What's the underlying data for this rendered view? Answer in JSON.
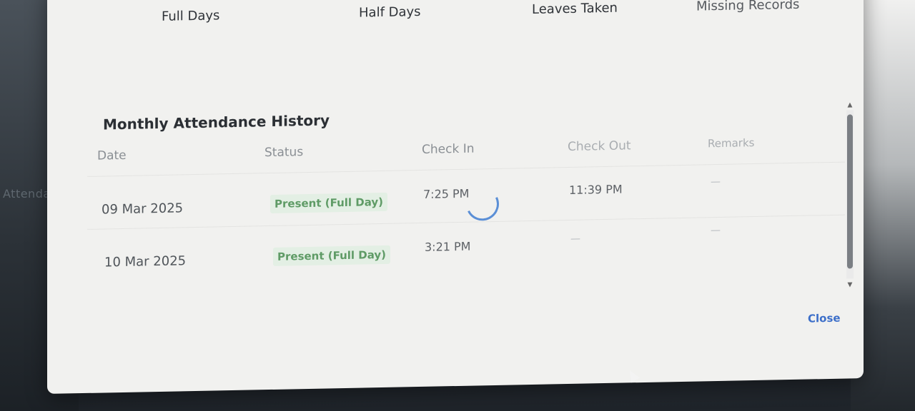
{
  "background": {
    "side_text": "Attenda"
  },
  "stats": {
    "labels": [
      "Full Days",
      "Half Days",
      "Leaves Taken",
      "Missing Records"
    ]
  },
  "history": {
    "title": "Monthly Attendance History",
    "columns": [
      "Date",
      "Status",
      "Check In",
      "Check Out",
      "Remarks"
    ],
    "rows": [
      {
        "date": "09 Mar 2025",
        "status": "Present (Full Day)",
        "check_in": "7:25 PM",
        "check_out": "11:39 PM",
        "remarks": "—"
      },
      {
        "date": "10 Mar 2025",
        "status": "Present (Full Day)",
        "check_in": "3:21 PM",
        "check_out": "—",
        "remarks": "—"
      }
    ]
  },
  "actions": {
    "close_label": "Close"
  },
  "colors": {
    "accent_blue": "#3d6fc9",
    "status_green": "#5f9b66",
    "status_bg": "#e3efe4",
    "spinner": "#5b8fd6"
  },
  "icons": {
    "loading": "loading-spinner-icon",
    "cursor": "mouse-pointer-icon",
    "scroll_up": "chevron-up-icon",
    "scroll_down": "chevron-down-icon"
  }
}
